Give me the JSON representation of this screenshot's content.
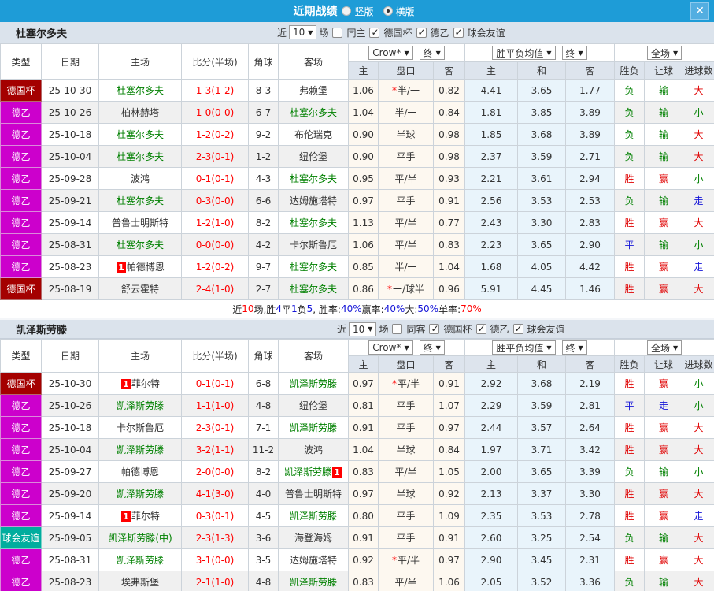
{
  "topbar": {
    "title": "近期战绩",
    "radio_vertical": "竖版",
    "radio_horizontal": "横版",
    "close_label": "X"
  },
  "filters": {
    "near_label": "近",
    "count": "10",
    "games_label": "场",
    "leagues": [
      "德国杯",
      "德乙",
      "球会友谊"
    ]
  },
  "columns": {
    "type": "类型",
    "date": "日期",
    "home": "主场",
    "score": "比分(半场)",
    "corner": "角球",
    "away": "客场",
    "crow_select": "Crow*",
    "final_select": "终",
    "mean_select": "胜平负均值",
    "scope_select": "全场",
    "odds_home": "主",
    "handicap": "盘口",
    "odds_away": "客",
    "mean_home": "主",
    "mean_draw": "和",
    "mean_away": "客",
    "result": "胜负",
    "handicap_result": "让球",
    "goals": "进球数"
  },
  "colors": {
    "topbar": "#1e9cd7",
    "cup_badge": "#a40000",
    "league2_badge": "#cc00cc",
    "friendly_badge": "#00ad9e",
    "team_green": "#008000",
    "score_red": "#ff0000",
    "blue": "#1515d8"
  },
  "sections": [
    {
      "team": "杜塞尔多夫",
      "same_label": "同主",
      "rows": [
        {
          "type": "德国杯",
          "date": "25-10-30",
          "home": "杜塞尔多夫",
          "hg": true,
          "hb": "",
          "score": "1-3(1-2)",
          "corner": "8-3",
          "away": "弗赖堡",
          "ag": false,
          "ab": "",
          "o1": "1.06",
          "star": true,
          "hc": "半/一",
          "o2": "0.82",
          "m1": "4.41",
          "m2": "3.65",
          "m3": "1.77",
          "res": "负",
          "let": "输",
          "goal": "大"
        },
        {
          "type": "德乙",
          "date": "25-10-26",
          "home": "柏林赫塔",
          "hg": false,
          "hb": "",
          "score": "1-0(0-0)",
          "corner": "6-7",
          "away": "杜塞尔多夫",
          "ag": true,
          "ab": "",
          "o1": "1.04",
          "star": false,
          "hc": "半/一",
          "o2": "0.84",
          "m1": "1.81",
          "m2": "3.85",
          "m3": "3.89",
          "res": "负",
          "let": "输",
          "goal": "小"
        },
        {
          "type": "德乙",
          "date": "25-10-18",
          "home": "杜塞尔多夫",
          "hg": true,
          "hb": "",
          "score": "1-2(0-2)",
          "corner": "9-2",
          "away": "布伦瑞克",
          "ag": false,
          "ab": "",
          "o1": "0.90",
          "star": false,
          "hc": "半球",
          "o2": "0.98",
          "m1": "1.85",
          "m2": "3.68",
          "m3": "3.89",
          "res": "负",
          "let": "输",
          "goal": "大"
        },
        {
          "type": "德乙",
          "date": "25-10-04",
          "home": "杜塞尔多夫",
          "hg": true,
          "hb": "",
          "score": "2-3(0-1)",
          "corner": "1-2",
          "away": "纽伦堡",
          "ag": false,
          "ab": "",
          "o1": "0.90",
          "star": false,
          "hc": "平手",
          "o2": "0.98",
          "m1": "2.37",
          "m2": "3.59",
          "m3": "2.71",
          "res": "负",
          "let": "输",
          "goal": "大"
        },
        {
          "type": "德乙",
          "date": "25-09-28",
          "home": "波鸿",
          "hg": false,
          "hb": "",
          "score": "0-1(0-1)",
          "corner": "4-3",
          "away": "杜塞尔多夫",
          "ag": true,
          "ab": "",
          "o1": "0.95",
          "star": false,
          "hc": "平/半",
          "o2": "0.93",
          "m1": "2.21",
          "m2": "3.61",
          "m3": "2.94",
          "res": "胜",
          "let": "赢",
          "goal": "小"
        },
        {
          "type": "德乙",
          "date": "25-09-21",
          "home": "杜塞尔多夫",
          "hg": true,
          "hb": "",
          "score": "0-3(0-0)",
          "corner": "6-6",
          "away": "达姆施塔特",
          "ag": false,
          "ab": "",
          "o1": "0.97",
          "star": false,
          "hc": "平手",
          "o2": "0.91",
          "m1": "2.56",
          "m2": "3.53",
          "m3": "2.53",
          "res": "负",
          "let": "输",
          "goal": "走"
        },
        {
          "type": "德乙",
          "date": "25-09-14",
          "home": "普鲁士明斯特",
          "hg": false,
          "hb": "",
          "score": "1-2(1-0)",
          "corner": "8-2",
          "away": "杜塞尔多夫",
          "ag": true,
          "ab": "",
          "o1": "1.13",
          "star": false,
          "hc": "平/半",
          "o2": "0.77",
          "m1": "2.43",
          "m2": "3.30",
          "m3": "2.83",
          "res": "胜",
          "let": "赢",
          "goal": "大"
        },
        {
          "type": "德乙",
          "date": "25-08-31",
          "home": "杜塞尔多夫",
          "hg": true,
          "hb": "",
          "score": "0-0(0-0)",
          "corner": "4-2",
          "away": "卡尔斯鲁厄",
          "ag": false,
          "ab": "",
          "o1": "1.06",
          "star": false,
          "hc": "平/半",
          "o2": "0.83",
          "m1": "2.23",
          "m2": "3.65",
          "m3": "2.90",
          "res": "平",
          "let": "输",
          "goal": "小"
        },
        {
          "type": "德乙",
          "date": "25-08-23",
          "home": "帕德博恩",
          "hg": false,
          "hb": "1",
          "score": "1-2(0-2)",
          "corner": "9-7",
          "away": "杜塞尔多夫",
          "ag": true,
          "ab": "",
          "o1": "0.85",
          "star": false,
          "hc": "半/一",
          "o2": "1.04",
          "m1": "1.68",
          "m2": "4.05",
          "m3": "4.42",
          "res": "胜",
          "let": "赢",
          "goal": "走"
        },
        {
          "type": "德国杯",
          "date": "25-08-19",
          "home": "舒云霍特",
          "hg": false,
          "hb": "",
          "score": "2-4(1-0)",
          "corner": "2-7",
          "away": "杜塞尔多夫",
          "ag": true,
          "ab": "",
          "o1": "0.86",
          "star": true,
          "hc": "一/球半",
          "o2": "0.96",
          "m1": "5.91",
          "m2": "4.45",
          "m3": "1.46",
          "res": "胜",
          "let": "赢",
          "goal": "大"
        }
      ],
      "summary": [
        {
          "t": "近",
          "c": "k"
        },
        {
          "t": "10",
          "c": "r"
        },
        {
          "t": "场,胜",
          "c": "k"
        },
        {
          "t": "4",
          "c": "b"
        },
        {
          "t": "平",
          "c": "k"
        },
        {
          "t": "1",
          "c": "b"
        },
        {
          "t": "负",
          "c": "k"
        },
        {
          "t": "5",
          "c": "b"
        },
        {
          "t": ", 胜率:",
          "c": "k"
        },
        {
          "t": "40%",
          "c": "b"
        },
        {
          "t": " 赢率:",
          "c": "k"
        },
        {
          "t": "40%",
          "c": "b"
        },
        {
          "t": " 大:",
          "c": "k"
        },
        {
          "t": "50%",
          "c": "b"
        },
        {
          "t": " 单率:",
          "c": "k"
        },
        {
          "t": "70%",
          "c": "r"
        }
      ]
    },
    {
      "team": "凯泽斯劳滕",
      "same_label": "同客",
      "rows": [
        {
          "type": "德国杯",
          "date": "25-10-30",
          "home": "菲尔特",
          "hg": false,
          "hb": "1",
          "score": "0-1(0-1)",
          "corner": "6-8",
          "away": "凯泽斯劳滕",
          "ag": true,
          "ab": "",
          "o1": "0.97",
          "star": true,
          "hc": "平/半",
          "o2": "0.91",
          "m1": "2.92",
          "m2": "3.68",
          "m3": "2.19",
          "res": "胜",
          "let": "赢",
          "goal": "小"
        },
        {
          "type": "德乙",
          "date": "25-10-26",
          "home": "凯泽斯劳滕",
          "hg": true,
          "hb": "",
          "score": "1-1(1-0)",
          "corner": "4-8",
          "away": "纽伦堡",
          "ag": false,
          "ab": "",
          "o1": "0.81",
          "star": false,
          "hc": "平手",
          "o2": "1.07",
          "m1": "2.29",
          "m2": "3.59",
          "m3": "2.81",
          "res": "平",
          "let": "走",
          "goal": "小"
        },
        {
          "type": "德乙",
          "date": "25-10-18",
          "home": "卡尔斯鲁厄",
          "hg": false,
          "hb": "",
          "score": "2-3(0-1)",
          "corner": "7-1",
          "away": "凯泽斯劳滕",
          "ag": true,
          "ab": "",
          "o1": "0.91",
          "star": false,
          "hc": "平手",
          "o2": "0.97",
          "m1": "2.44",
          "m2": "3.57",
          "m3": "2.64",
          "res": "胜",
          "let": "赢",
          "goal": "大"
        },
        {
          "type": "德乙",
          "date": "25-10-04",
          "home": "凯泽斯劳滕",
          "hg": true,
          "hb": "",
          "score": "3-2(1-1)",
          "corner": "11-2",
          "away": "波鸿",
          "ag": false,
          "ab": "",
          "o1": "1.04",
          "star": false,
          "hc": "半球",
          "o2": "0.84",
          "m1": "1.97",
          "m2": "3.71",
          "m3": "3.42",
          "res": "胜",
          "let": "赢",
          "goal": "大"
        },
        {
          "type": "德乙",
          "date": "25-09-27",
          "home": "帕德博恩",
          "hg": false,
          "hb": "",
          "score": "2-0(0-0)",
          "corner": "8-2",
          "away": "凯泽斯劳滕",
          "ag": true,
          "ab": "1",
          "o1": "0.83",
          "star": false,
          "hc": "平/半",
          "o2": "1.05",
          "m1": "2.00",
          "m2": "3.65",
          "m3": "3.39",
          "res": "负",
          "let": "输",
          "goal": "小"
        },
        {
          "type": "德乙",
          "date": "25-09-20",
          "home": "凯泽斯劳滕",
          "hg": true,
          "hb": "",
          "score": "4-1(3-0)",
          "corner": "4-0",
          "away": "普鲁士明斯特",
          "ag": false,
          "ab": "",
          "o1": "0.97",
          "star": false,
          "hc": "半球",
          "o2": "0.92",
          "m1": "2.13",
          "m2": "3.37",
          "m3": "3.30",
          "res": "胜",
          "let": "赢",
          "goal": "大"
        },
        {
          "type": "德乙",
          "date": "25-09-14",
          "home": "菲尔特",
          "hg": false,
          "hb": "1",
          "score": "0-3(0-1)",
          "corner": "4-5",
          "away": "凯泽斯劳滕",
          "ag": true,
          "ab": "",
          "o1": "0.80",
          "star": false,
          "hc": "平手",
          "o2": "1.09",
          "m1": "2.35",
          "m2": "3.53",
          "m3": "2.78",
          "res": "胜",
          "let": "赢",
          "goal": "走"
        },
        {
          "type": "球会友谊",
          "date": "25-09-05",
          "home": "凯泽斯劳滕(中)",
          "hg": true,
          "hb": "",
          "score": "2-3(1-3)",
          "corner": "3-6",
          "away": "海登海姆",
          "ag": false,
          "ab": "",
          "o1": "0.91",
          "star": false,
          "hc": "平手",
          "o2": "0.91",
          "m1": "2.60",
          "m2": "3.25",
          "m3": "2.54",
          "res": "负",
          "let": "输",
          "goal": "大"
        },
        {
          "type": "德乙",
          "date": "25-08-31",
          "home": "凯泽斯劳滕",
          "hg": true,
          "hb": "",
          "score": "3-1(0-0)",
          "corner": "3-5",
          "away": "达姆施塔特",
          "ag": false,
          "ab": "",
          "o1": "0.92",
          "star": true,
          "hc": "平/半",
          "o2": "0.97",
          "m1": "2.90",
          "m2": "3.45",
          "m3": "2.31",
          "res": "胜",
          "let": "赢",
          "goal": "大"
        },
        {
          "type": "德乙",
          "date": "25-08-23",
          "home": "埃弗斯堡",
          "hg": false,
          "hb": "",
          "score": "2-1(1-0)",
          "corner": "4-8",
          "away": "凯泽斯劳滕",
          "ag": true,
          "ab": "",
          "o1": "0.83",
          "star": false,
          "hc": "平/半",
          "o2": "1.06",
          "m1": "2.05",
          "m2": "3.52",
          "m3": "3.36",
          "res": "负",
          "let": "输",
          "goal": "大"
        }
      ]
    }
  ]
}
